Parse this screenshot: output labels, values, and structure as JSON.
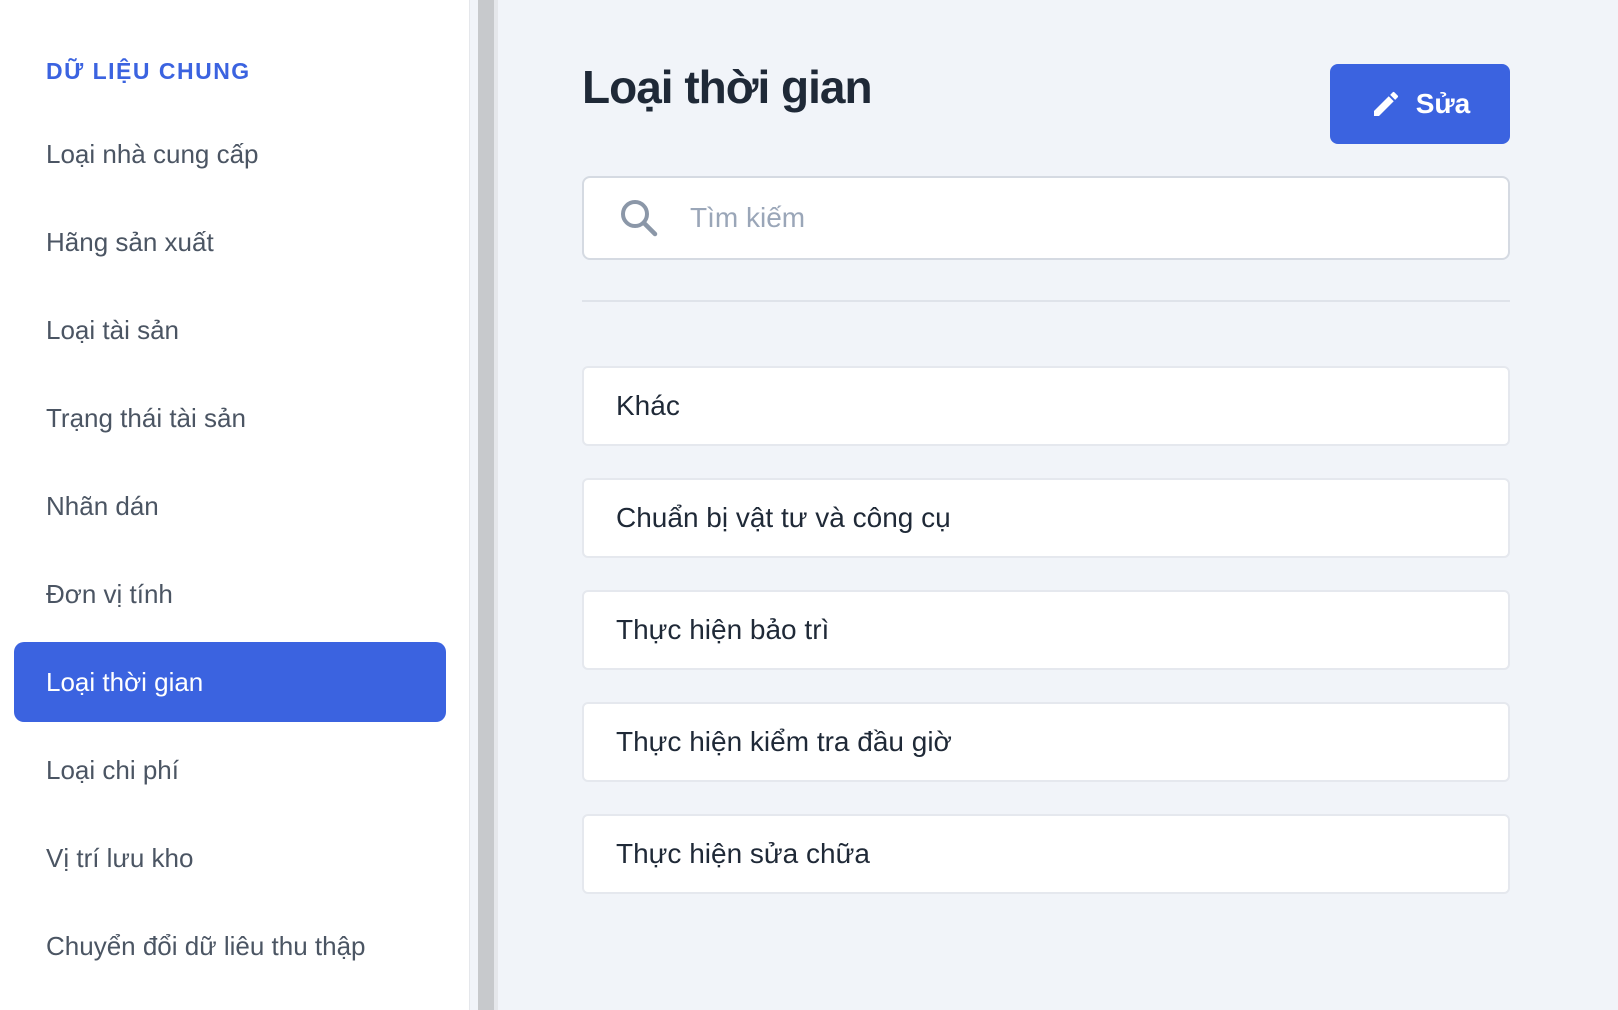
{
  "sidebar": {
    "section_title": "DỮ LIỆU CHUNG",
    "items": [
      {
        "label": "Loại nhà cung cấp"
      },
      {
        "label": "Hãng sản xuất"
      },
      {
        "label": "Loại tài sản"
      },
      {
        "label": "Trạng thái tài sản"
      },
      {
        "label": "Nhãn dán"
      },
      {
        "label": "Đơn vị tính"
      },
      {
        "label": "Loại thời gian",
        "active": true
      },
      {
        "label": "Loại chi phí"
      },
      {
        "label": "Vị trí lưu kho"
      },
      {
        "label": "Chuyển đổi dữ liêu thu thập"
      }
    ]
  },
  "main": {
    "title": "Loại thời gian",
    "edit_button": {
      "label": "Sửa",
      "icon": "pencil-icon"
    },
    "search": {
      "placeholder": "Tìm kiếm",
      "value": "",
      "icon": "search-icon"
    },
    "items": [
      {
        "label": "Khác"
      },
      {
        "label": "Chuẩn bị vật tư và công cụ"
      },
      {
        "label": "Thực hiện bảo trì"
      },
      {
        "label": "Thực hiện kiểm tra đầu giờ"
      },
      {
        "label": "Thực hiện sửa chữa"
      }
    ]
  },
  "colors": {
    "accent": "#3b63e0",
    "background": "#f1f4f9",
    "sidebar_background": "#ffffff",
    "text": "#1f2937",
    "muted_text": "#4b5563"
  }
}
